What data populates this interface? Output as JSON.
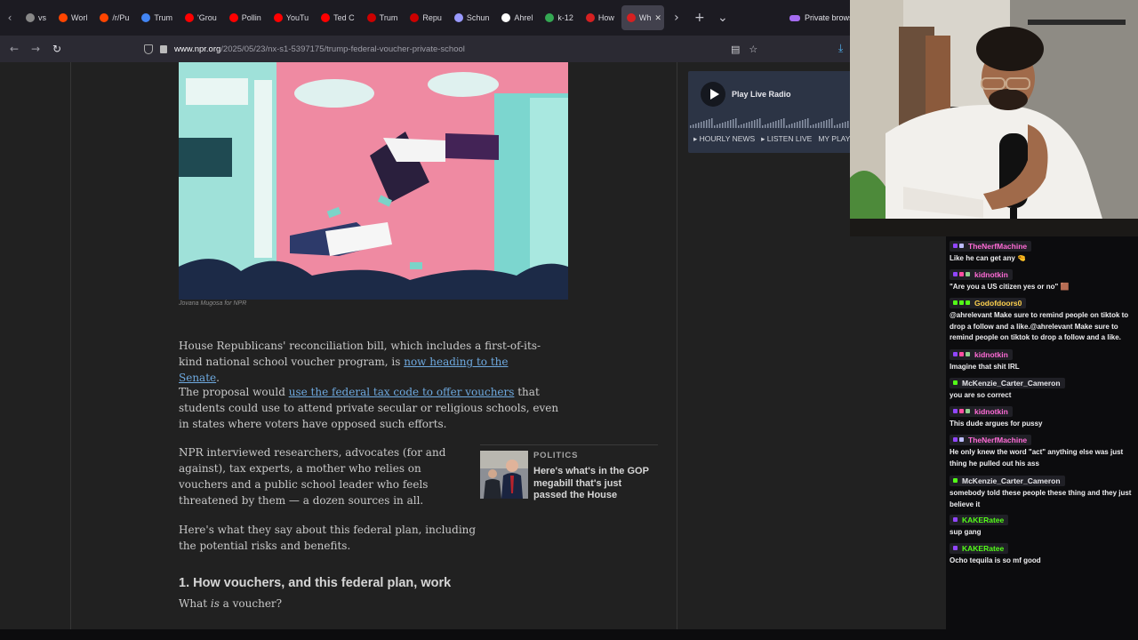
{
  "browser": {
    "tabs": [
      {
        "label": "vs",
        "icon": "generic-page-icon",
        "color": "#888888"
      },
      {
        "label": "Worl",
        "icon": "reddit-icon",
        "color": "#ff4500"
      },
      {
        "label": "/r/Pu",
        "icon": "reddit-icon",
        "color": "#ff4500"
      },
      {
        "label": "Trum",
        "icon": "google-icon",
        "color": "#4285f4"
      },
      {
        "label": "'Grou",
        "icon": "youtube-icon",
        "color": "#ff0000"
      },
      {
        "label": "Pollin",
        "icon": "youtube-icon",
        "color": "#ff0000"
      },
      {
        "label": "YouTu",
        "icon": "youtube-icon",
        "color": "#ff0000"
      },
      {
        "label": "Ted C",
        "icon": "youtube-icon",
        "color": "#ff0000"
      },
      {
        "label": "Trum",
        "icon": "cnn-icon",
        "color": "#cc0000"
      },
      {
        "label": "Repu",
        "icon": "cnn-icon",
        "color": "#cc0000"
      },
      {
        "label": "Schun",
        "icon": "generic-page-icon",
        "color": "#9a9aff"
      },
      {
        "label": "Ahrel",
        "icon": "tiktok-icon",
        "color": "#ffffff"
      },
      {
        "label": "k-12",
        "icon": "google-icon",
        "color": "#34a853"
      },
      {
        "label": "How",
        "icon": "npr-icon",
        "color": "#d62021"
      },
      {
        "label": "Wh",
        "icon": "npr-icon",
        "color": "#d62021",
        "active": true
      }
    ],
    "private_label": "Private browsi",
    "url_domain": "www.npr.org",
    "url_path": "/2025/05/23/nx-s1-5397175/trump-federal-voucher-private-school"
  },
  "article": {
    "caption": "Jovana Mugosa for NPR",
    "p1_before": "House Republicans' reconciliation bill, which includes a first-of-its-kind national school voucher program, is ",
    "p1_link": "now heading to the Senate",
    "p1_after": ".",
    "p2_before": "The proposal would ",
    "p2_link": "use the federal tax code to offer vouchers",
    "p2_after": " that students could use to attend private secular or religious schools, even in states where voters have opposed such efforts.",
    "p3": "NPR interviewed researchers, advocates (for and against), tax experts, a mother who relies on vouchers and a public school leader who feels threatened by them — a dozen sources in all.",
    "p4": "Here's what they say about this federal plan, including the potential risks and benefits.",
    "heading": "1. How vouchers, and this federal plan, work",
    "what_before": "What ",
    "what_em": "is",
    "what_after": " a voucher?",
    "related": {
      "category": "POLITICS",
      "title": "Here's what's in the GOP megabill that's just passed the House"
    }
  },
  "player": {
    "label": "Play Live Radio",
    "links": [
      "▸ HOURLY NEWS",
      "▸ LISTEN LIVE",
      "MY PLAYL"
    ]
  },
  "chat": {
    "messages": [
      {
        "user": "TheNerfMachine",
        "color": "#ff6bd6",
        "badges": [
          "#9146ff",
          "#bdbdff"
        ],
        "text": "Like he can get any 🤏"
      },
      {
        "user": "kidnotkin",
        "color": "#ff6bd6",
        "badges": [
          "#9146ff",
          "#ff4fa0",
          "#8fd18f"
        ],
        "text": "\"Are you a US citizen yes or no\" 🟫"
      },
      {
        "user": "Godofdoors0",
        "color": "#ffd24d",
        "badges": [
          "#53fc18",
          "#53fc18",
          "#53fc18"
        ],
        "text": "@ahrelevant Make sure to remind people on tiktok to drop a follow and a like.@ahrelevant Make sure to remind people on tiktok to drop a follow and a like."
      },
      {
        "user": "kidnotkin",
        "color": "#ff6bd6",
        "badges": [
          "#9146ff",
          "#ff4fa0",
          "#8fd18f"
        ],
        "text": "Imagine that shit IRL"
      },
      {
        "user": "McKenzie_Carter_Cameron",
        "color": "#e6e6ea",
        "badges": [
          "#53fc18"
        ],
        "text": "you are so correct"
      },
      {
        "user": "kidnotkin",
        "color": "#ff6bd6",
        "badges": [
          "#9146ff",
          "#ff4fa0",
          "#8fd18f"
        ],
        "text": "This dude argues for pussy"
      },
      {
        "user": "TheNerfMachine",
        "color": "#ff6bd6",
        "badges": [
          "#9146ff",
          "#bdbdff"
        ],
        "text": "He only knew the word \"act\" anything else was just thing he pulled out his ass"
      },
      {
        "user": "McKenzie_Carter_Cameron",
        "color": "#e6e6ea",
        "badges": [
          "#53fc18"
        ],
        "text": "somebody told these people these thing and they just believe it"
      },
      {
        "user": "KAKERatee",
        "color": "#53fc18",
        "badges": [
          "#9146ff"
        ],
        "text": "sup gang"
      },
      {
        "user": "KAKERatee",
        "color": "#53fc18",
        "badges": [
          "#9146ff"
        ],
        "text": "Ocho tequila is so mf good"
      }
    ]
  }
}
